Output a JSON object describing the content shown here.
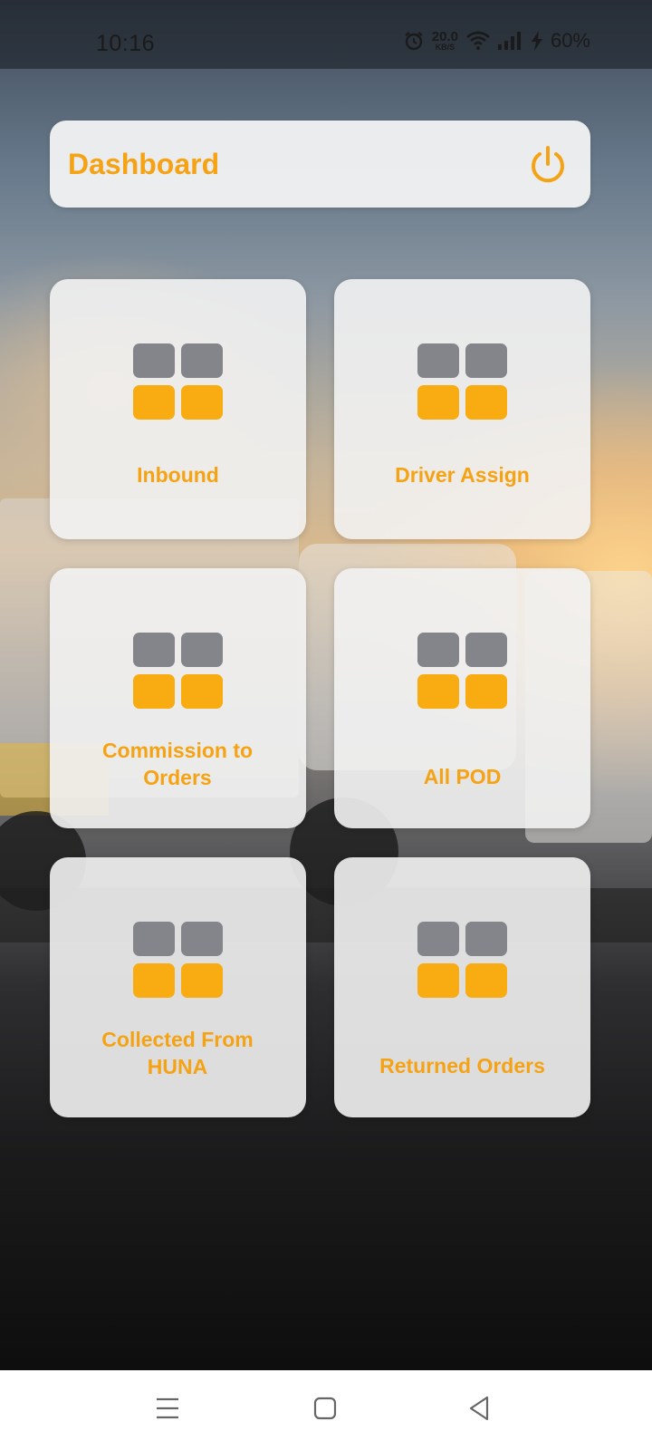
{
  "status_bar": {
    "time": "10:16",
    "net_speed_value": "20.0",
    "net_speed_unit": "KB/S",
    "battery": "60%",
    "icons": [
      "alarm-icon",
      "wifi-icon",
      "signal-icon",
      "charging-icon"
    ]
  },
  "header": {
    "title": "Dashboard",
    "power_icon": "power-icon"
  },
  "colors": {
    "accent": "#f5a315",
    "icon_gray": "#84858a",
    "icon_orange": "#f9ab12"
  },
  "tiles": [
    {
      "label": "Inbound",
      "icon": "grid-icon"
    },
    {
      "label": "Driver Assign",
      "icon": "grid-icon"
    },
    {
      "label": "Commission to Orders",
      "icon": "grid-icon"
    },
    {
      "label": "All POD",
      "icon": "grid-icon"
    },
    {
      "label": "Collected From HUNA",
      "icon": "grid-icon"
    },
    {
      "label": "Returned Orders",
      "icon": "grid-icon"
    }
  ],
  "nav_bar": {
    "buttons": [
      "menu-icon",
      "home-icon",
      "back-icon"
    ]
  }
}
